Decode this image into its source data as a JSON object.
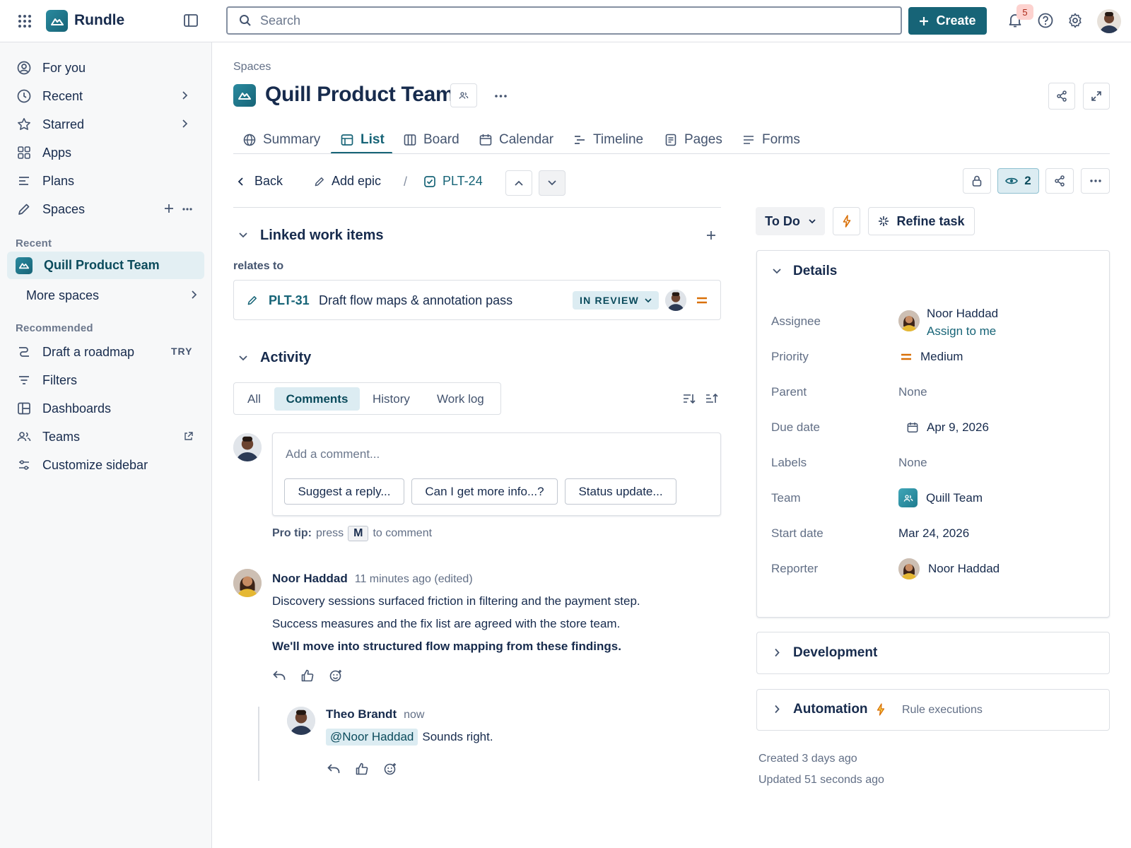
{
  "app": {
    "name": "Rundle"
  },
  "search": {
    "placeholder": "Search"
  },
  "topbar": {
    "create_label": "Create",
    "notification_count": "5"
  },
  "sidebar": {
    "items": [
      {
        "label": "For you"
      },
      {
        "label": "Recent"
      },
      {
        "label": "Starred"
      },
      {
        "label": "Apps"
      },
      {
        "label": "Plans"
      },
      {
        "label": "Spaces"
      }
    ],
    "recent_label": "Recent",
    "recent_space": "Quill Product Team",
    "more_spaces": "More spaces",
    "recommended_label": "Recommended",
    "recommended": [
      {
        "label": "Draft a roadmap",
        "badge": "TRY"
      },
      {
        "label": "Filters"
      },
      {
        "label": "Dashboards"
      },
      {
        "label": "Teams"
      },
      {
        "label": "Customize sidebar"
      }
    ]
  },
  "page": {
    "breadcrumb": "Spaces",
    "title": "Quill Product Team",
    "tabs": [
      "Summary",
      "List",
      "Board",
      "Calendar",
      "Timeline",
      "Pages",
      "Forms"
    ],
    "active_tab": "List"
  },
  "issue_nav": {
    "back": "Back",
    "add_epic": "Add epic",
    "separator": "/",
    "key": "PLT-24",
    "watchers": "2"
  },
  "linked": {
    "heading": "Linked work items",
    "relation": "relates to",
    "item": {
      "key": "PLT-31",
      "title": "Draft flow maps & annotation pass",
      "status": "IN REVIEW"
    }
  },
  "activity": {
    "heading": "Activity",
    "filters": [
      "All",
      "Comments",
      "History",
      "Work log"
    ],
    "active_filter": "Comments",
    "comment_placeholder": "Add a comment...",
    "suggestions": [
      "Suggest a reply...",
      "Can I get more info...?",
      "Status update..."
    ],
    "protip_label": "Pro tip:",
    "protip_press": "press",
    "protip_key": "M",
    "protip_rest": "to comment"
  },
  "comments": [
    {
      "author": "Noor Haddad",
      "time": "11 minutes ago (edited)",
      "lines": [
        "Discovery sessions surfaced friction in filtering and the payment step.",
        "Success measures and the fix list are agreed with the store team."
      ],
      "bold_line": "We'll move into structured flow mapping from these findings."
    },
    {
      "author": "Theo Brandt",
      "time": "now",
      "mention": "@Noor Haddad",
      "text": "Sounds right."
    }
  ],
  "right": {
    "status": "To Do",
    "refine": "Refine task",
    "details_heading": "Details",
    "fields": {
      "assignee_label": "Assignee",
      "assignee": "Noor Haddad",
      "assign_to_me": "Assign to me",
      "priority_label": "Priority",
      "priority": "Medium",
      "parent_label": "Parent",
      "parent": "None",
      "due_label": "Due date",
      "due": "Apr 9, 2026",
      "labels_label": "Labels",
      "labels": "None",
      "team_label": "Team",
      "team": "Quill Team",
      "start_label": "Start date",
      "start": "Mar 24, 2026",
      "reporter_label": "Reporter",
      "reporter": "Noor Haddad"
    },
    "development": "Development",
    "automation": "Automation",
    "rule_executions": "Rule executions",
    "created": "Created 3 days ago",
    "updated": "Updated 51 seconds ago"
  },
  "colors": {
    "brand": "#176477",
    "accent": "#0c66e4",
    "priority": "#d97008",
    "status_bg": "#dcecf2"
  }
}
